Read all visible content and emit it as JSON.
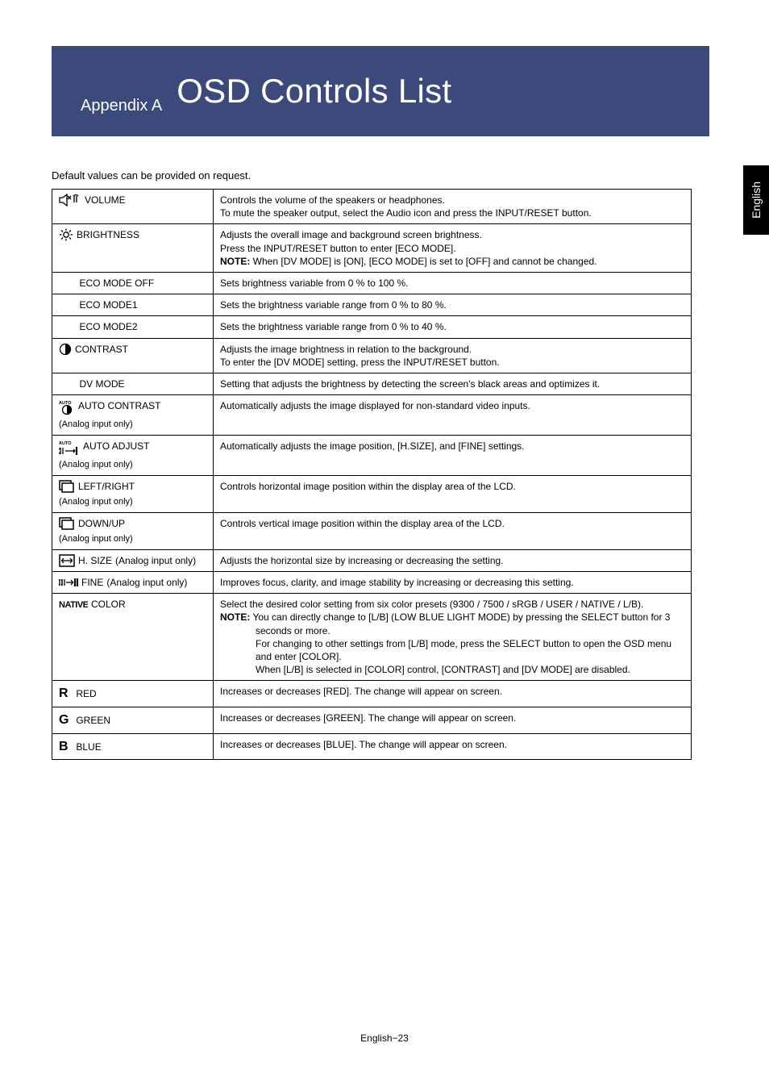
{
  "banner": {
    "pre": "Appendix A",
    "title": "OSD Controls List"
  },
  "sideTab": "English",
  "intro": "Default values can be provided on request.",
  "footer": "English−23",
  "rows": {
    "volume": {
      "label": "VOLUME",
      "l1": "Controls the volume of the speakers or headphones.",
      "l2": "To mute the speaker output, select the Audio icon and press the INPUT/RESET button."
    },
    "brightness": {
      "label": "BRIGHTNESS",
      "l1": "Adjusts the overall image and background screen brightness.",
      "l2": "Press the INPUT/RESET button to enter [ECO MODE].",
      "noteLabel": "NOTE:",
      "noteText": "  When [DV MODE] is [ON], [ECO MODE] is set to [OFF] and cannot be changed."
    },
    "ecoOff": {
      "label": "ECO MODE OFF",
      "desc": "Sets brightness variable from 0 % to 100 %."
    },
    "eco1": {
      "label": "ECO MODE1",
      "desc": "Sets the brightness variable range from 0 % to 80 %."
    },
    "eco2": {
      "label": "ECO MODE2",
      "desc": "Sets the brightness variable range from 0 % to 40 %."
    },
    "contrast": {
      "label": "CONTRAST",
      "l1": "Adjusts the image brightness in relation to the background.",
      "l2": "To enter the [DV MODE] setting, press the INPUT/RESET button."
    },
    "dv": {
      "label": "DV MODE",
      "desc": "Setting that adjusts the brightness by detecting the screen's black areas and optimizes it."
    },
    "autoContrast": {
      "label": "AUTO CONTRAST",
      "note": "(Analog input only)",
      "desc": "Automatically adjusts the image displayed for non-standard video inputs."
    },
    "autoAdjust": {
      "label": "AUTO ADJUST",
      "note": "(Analog input only)",
      "desc": "Automatically adjusts the image position, [H.SIZE], and [FINE] settings."
    },
    "leftRight": {
      "label": "LEFT/RIGHT",
      "note": "(Analog input only)",
      "desc": "Controls horizontal image position within the display area of the LCD."
    },
    "downUp": {
      "label": "DOWN/UP",
      "note": "(Analog input only)",
      "desc": "Controls vertical image position within the display area of the LCD."
    },
    "hsize": {
      "label": "H. SIZE",
      "note": "(Analog input only)",
      "desc": "Adjusts the horizontal size by increasing or decreasing the setting."
    },
    "fine": {
      "label": "FINE",
      "note": "(Analog input only)",
      "desc": "Improves focus, clarity, and image stability by increasing or decreasing this setting."
    },
    "color": {
      "label": "COLOR",
      "l1": "Select the desired color setting from six color presets (9300 / 7500 / sRGB / USER / NATIVE / L/B).",
      "noteLabel": "NOTE:",
      "n1": "  You can directly change to [L/B] (LOW BLUE LIGHT MODE) by pressing the SELECT button for 3 seconds or more.",
      "n2": "For changing to other settings from [L/B] mode, press the SELECT button to open the OSD menu and enter [COLOR].",
      "n3": "When [L/B] is selected in [COLOR] control, [CONTRAST] and [DV MODE] are disabled."
    },
    "red": {
      "letter": "R",
      "label": "RED",
      "desc": "Increases or decreases [RED]. The change will appear on screen."
    },
    "green": {
      "letter": "G",
      "label": "GREEN",
      "desc": "Increases or decreases [GREEN]. The change will appear on screen."
    },
    "blue": {
      "letter": "B",
      "label": "BLUE",
      "desc": "Increases or decreases [BLUE]. The change will appear on screen."
    }
  }
}
